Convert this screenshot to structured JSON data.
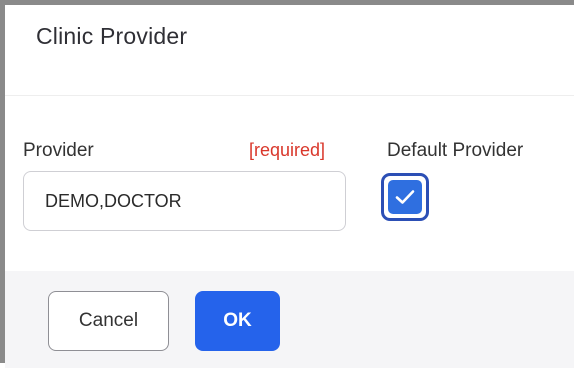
{
  "dialog": {
    "title": "Clinic Provider"
  },
  "form": {
    "provider_label": "Provider",
    "required_label": "[required]",
    "provider_value": "DEMO,DOCTOR",
    "default_provider_label": "Default Provider",
    "default_provider_checked": true
  },
  "footer": {
    "cancel_label": "Cancel",
    "ok_label": "OK"
  },
  "colors": {
    "accent": "#2563eb",
    "required": "#d9372b",
    "checkbox_focus": "#2c4fb5"
  },
  "icons": {
    "checkbox_mark": "check-icon"
  }
}
